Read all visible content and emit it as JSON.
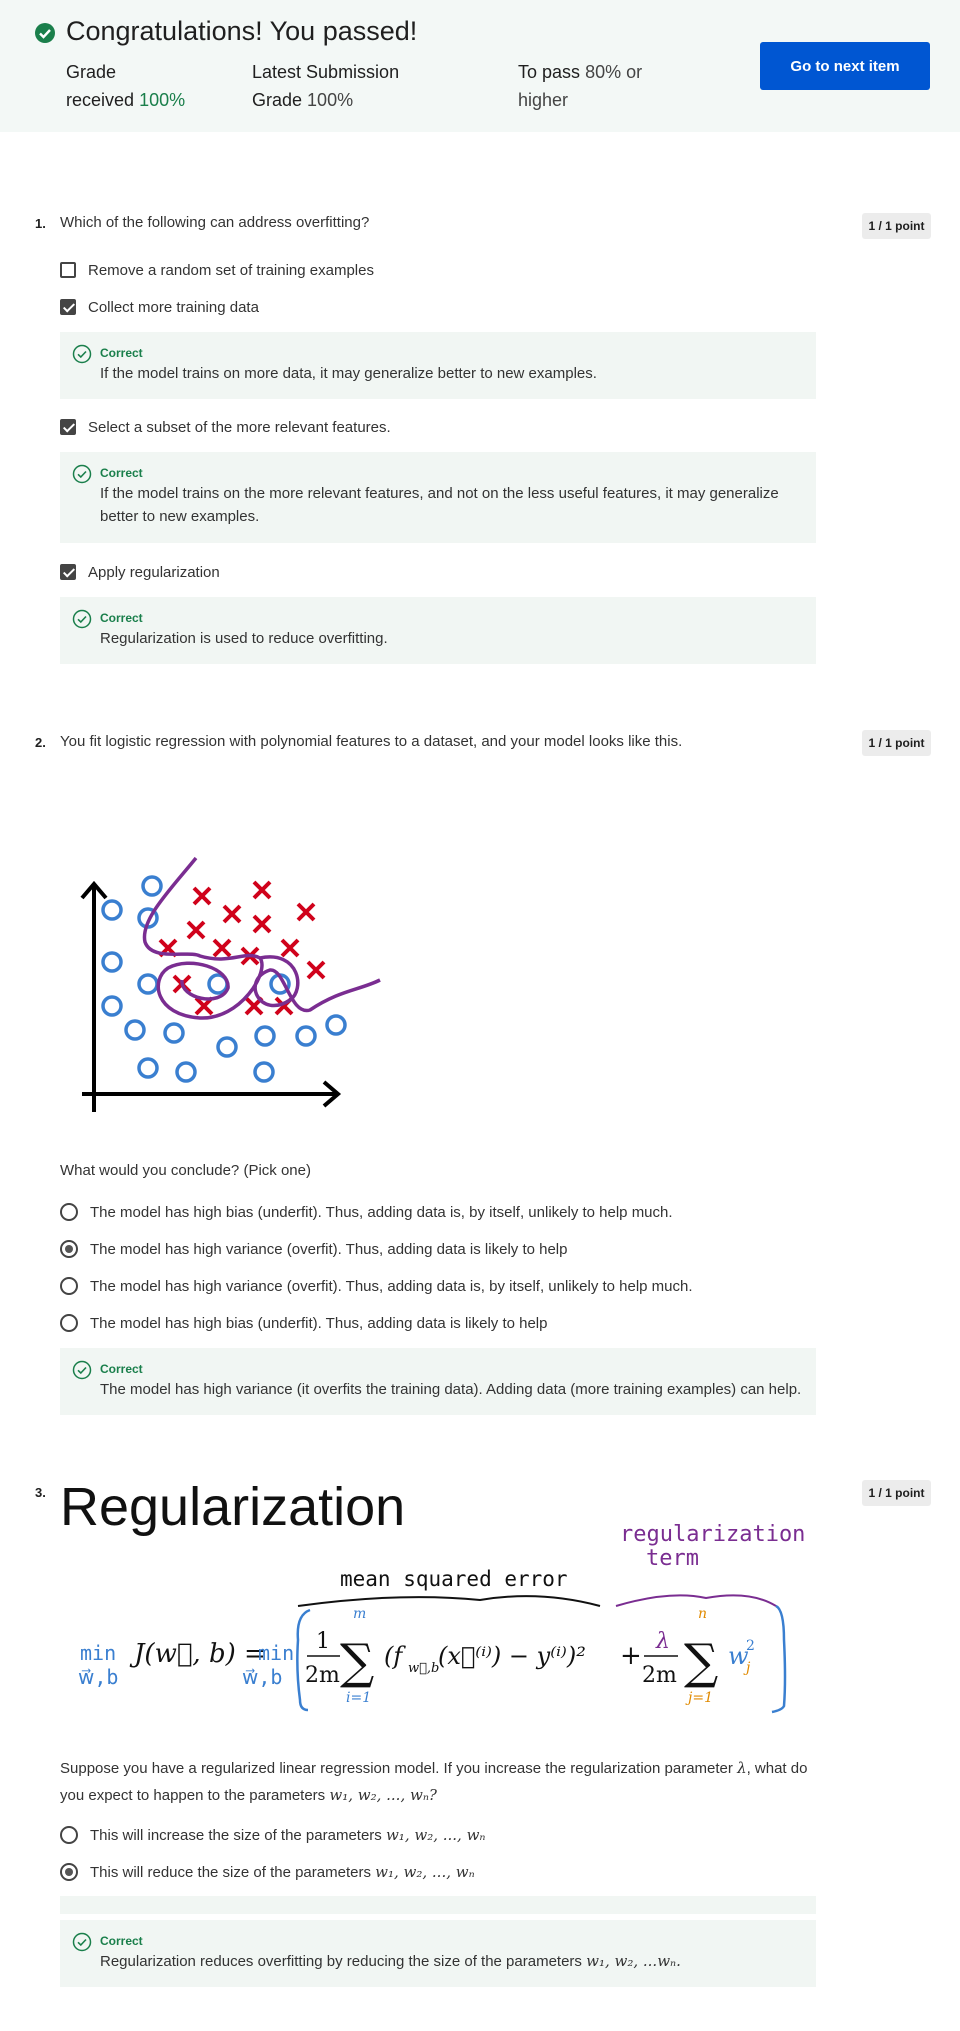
{
  "banner": {
    "title": "Congratulations! You passed!",
    "grade_label_1": "Grade",
    "grade_label_2": "received",
    "grade_value": "100%",
    "latest_label_1": "Latest Submission",
    "latest_label_2": "Grade",
    "latest_value": "100%",
    "pass_label": "To pass",
    "pass_value_1": "80% or",
    "pass_value_2": "higher",
    "next_button": "Go to next item",
    "accent_color": "#0056d2",
    "success_color": "#1a7f4b"
  },
  "q1": {
    "number": "1.",
    "text": "Which of the following can address overfitting?",
    "points": "1 / 1 point",
    "options": [
      {
        "label": "Remove a random set of training examples",
        "checked": false
      },
      {
        "label": "Collect more training data",
        "checked": true
      },
      {
        "label": "Select a subset of the more relevant features.",
        "checked": true
      },
      {
        "label": "Apply regularization",
        "checked": true
      }
    ],
    "feedback": [
      {
        "title": "Correct",
        "text": "If the model trains on more data, it may generalize better to new examples."
      },
      {
        "title": "Correct",
        "text_1": "If the model trains on the more relevant features, and not on the less useful features, it may generalize",
        "text_2": "better to new examples."
      },
      {
        "title": "Correct",
        "text": "Regularization is used to reduce overfitting."
      }
    ]
  },
  "q2": {
    "number": "2.",
    "text": "You fit logistic regression with polynomial features to a dataset, and your model looks like this.",
    "points": "1 / 1 point",
    "prompt": "What would you conclude? (Pick one)",
    "options": [
      {
        "label": "The model has high bias (underfit). Thus, adding data is, by itself, unlikely to help much.",
        "selected": false
      },
      {
        "label": "The model has high variance (overfit). Thus, adding data is likely to help",
        "selected": true
      },
      {
        "label": "The model has high variance (overfit). Thus, adding data is, by itself, unlikely to help much.",
        "selected": false
      },
      {
        "label": "The model has high bias (underfit). Thus, adding data is likely to help",
        "selected": false
      }
    ],
    "feedback": {
      "title": "Correct",
      "text": "The model has high variance (it overfits the training data). Adding data (more training examples) can help."
    }
  },
  "q3": {
    "number": "3.",
    "points": "1 / 1 point",
    "slide": {
      "title": "Regularization",
      "annotation_mse": "mean squared error",
      "annotation_reg_1": "regularization",
      "annotation_reg_2": "term",
      "min_label": "min",
      "min_sub": "w⃗,b",
      "lhs": "J(w⃗, b) =",
      "frac_num": "1",
      "frac_den": "2m",
      "sum_top": "m",
      "sum_bottom": "i=1",
      "term": "(f",
      "term_sub": "w⃗,b",
      "term_rest": "(x⃗⁽ⁱ⁾) − y⁽ⁱ⁾)²",
      "plus": "+",
      "lambda": "λ",
      "sum2_top": "n",
      "sum2_bottom": "j=1",
      "w_term": "w",
      "w_sub": "j",
      "w_sup": "2"
    },
    "text_1": "Suppose you have a regularized linear regression model.  If you increase the regularization parameter",
    "lambda": "λ",
    "text_2": ", what do",
    "text_3": "you expect to happen to the parameters",
    "params": "w₁, w₂, ..., wₙ?",
    "options": [
      {
        "label": "This will increase the size of the parameters",
        "params": "w₁, w₂, ..., wₙ",
        "selected": false
      },
      {
        "label": "This will reduce the size of the parameters",
        "params": "w₁, w₂, ..., wₙ",
        "selected": true
      }
    ],
    "feedback": {
      "title": "Correct",
      "text": "Regularization reduces overfitting by reducing the size of the parameters",
      "params": "w₁, w₂, ...wₙ."
    }
  }
}
